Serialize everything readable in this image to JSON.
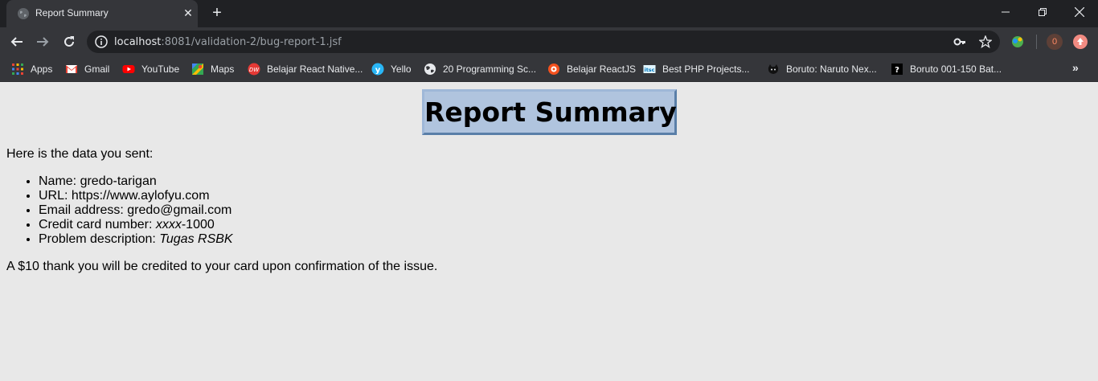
{
  "browser": {
    "tab": {
      "title": "Report Summary",
      "favicon": "globe-icon"
    },
    "address": {
      "host": "localhost",
      "rest": ":8081/validation-2/bug-report-1.jsf"
    },
    "extensions": {
      "badge_count": "0"
    },
    "bookmarks": [
      {
        "label": "Apps",
        "icon": "apps-grid-icon"
      },
      {
        "label": "Gmail",
        "icon": "gmail-icon"
      },
      {
        "label": "YouTube",
        "icon": "youtube-icon"
      },
      {
        "label": "Maps",
        "icon": "maps-icon"
      },
      {
        "label": "Belajar React Native...",
        "icon": "site-icon"
      },
      {
        "label": "Yello",
        "icon": "site-icon"
      },
      {
        "label": "20 Programming Sc...",
        "icon": "globe-icon"
      },
      {
        "label": "Belajar ReactJS",
        "icon": "site-icon"
      },
      {
        "label": "Best PHP Projects...",
        "icon": "site-icon"
      },
      {
        "label": "Boruto: Naruto Nex...",
        "icon": "site-icon"
      },
      {
        "label": "Boruto 001-150 Bat...",
        "icon": "site-icon"
      }
    ]
  },
  "report": {
    "title": "Report Summary",
    "intro": "Here is the data you sent:",
    "items": [
      {
        "label": "Name:",
        "value": "gredo-tarigan"
      },
      {
        "label": "URL:",
        "value": "https://www.aylofyu.com"
      },
      {
        "label": "Email address:",
        "value": "gredo@gmail.com"
      },
      {
        "label": "Credit card number:",
        "value_masked": "xxxx",
        "value_rest": "-1000"
      },
      {
        "label": "Problem description:",
        "value": "Tugas RSBK"
      }
    ],
    "footer": "A $10 thank you will be credited to your card upon confirmation of the issue."
  },
  "colors": {
    "title_bg": "#b0c4de",
    "page_bg": "#e8e8e8",
    "chrome_dark": "#202124",
    "chrome": "#35363a"
  }
}
